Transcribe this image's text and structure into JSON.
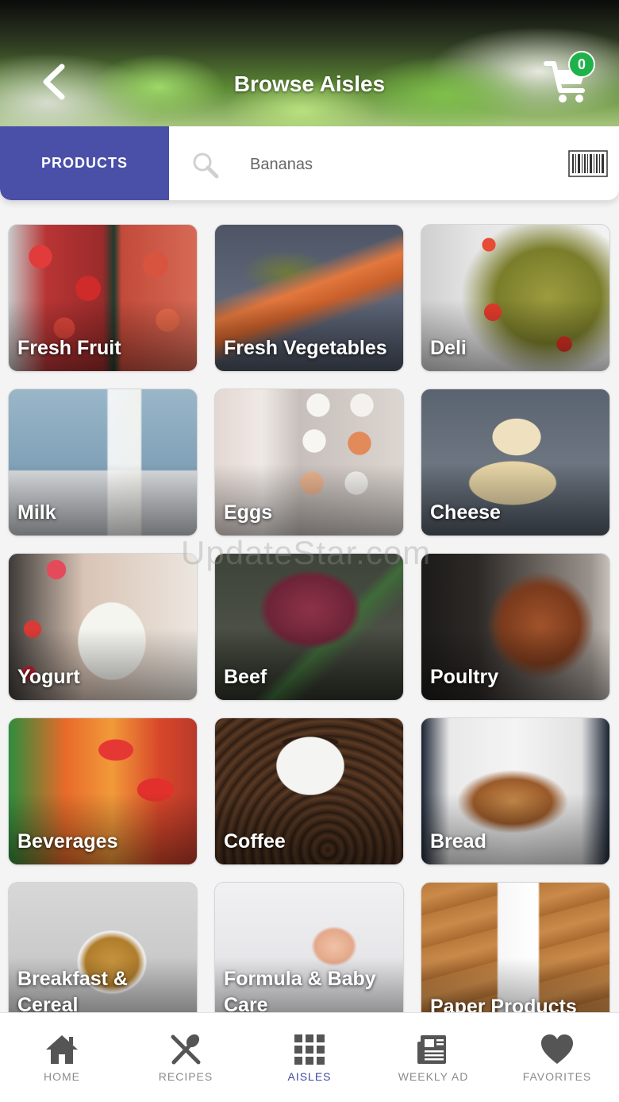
{
  "header": {
    "title": "Browse Aisles",
    "cart_count": "0"
  },
  "search": {
    "products_tab_label": "PRODUCTS",
    "placeholder": "Bananas"
  },
  "aisles": [
    {
      "label": "Fresh Fruit"
    },
    {
      "label": "Fresh Vegetables"
    },
    {
      "label": "Deli"
    },
    {
      "label": "Milk"
    },
    {
      "label": "Eggs"
    },
    {
      "label": "Cheese"
    },
    {
      "label": "Yogurt"
    },
    {
      "label": "Beef"
    },
    {
      "label": "Poultry"
    },
    {
      "label": "Beverages"
    },
    {
      "label": "Coffee"
    },
    {
      "label": "Bread"
    },
    {
      "label": "Breakfast & Cereal"
    },
    {
      "label": "Formula & Baby Care"
    },
    {
      "label": "Paper Products"
    }
  ],
  "tabbar": {
    "items": [
      {
        "label": "HOME",
        "icon": "home-icon"
      },
      {
        "label": "RECIPES",
        "icon": "utensils-icon"
      },
      {
        "label": "AISLES",
        "icon": "grid-icon",
        "active": true
      },
      {
        "label": "WEEKLY AD",
        "icon": "newspaper-icon"
      },
      {
        "label": "FAVORITES",
        "icon": "heart-icon"
      }
    ]
  },
  "watermark": "UpdateStar.com",
  "colors": {
    "accent": "#4a4fa8",
    "badge": "#1fb24a",
    "tab_inactive": "#8b8b8b",
    "tab_active": "#3f4aa0"
  }
}
